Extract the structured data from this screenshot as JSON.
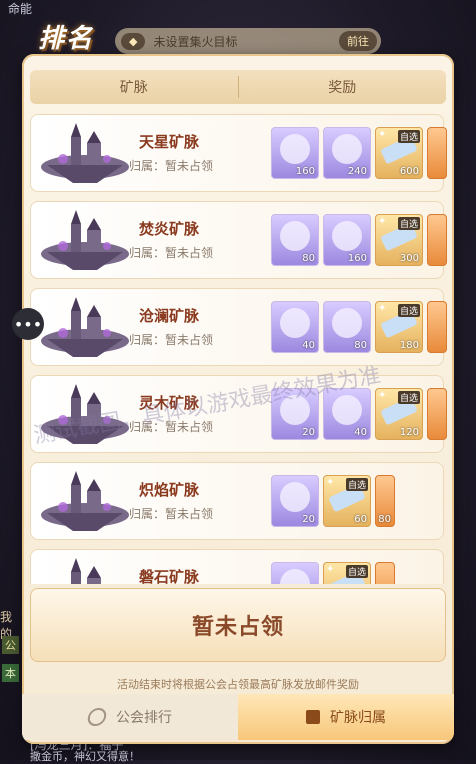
{
  "header": {
    "title": "排名",
    "status_left": "未设置集火目标",
    "status_right": "前往"
  },
  "tabs": {
    "left": "矿脉",
    "right": "奖励"
  },
  "mines": [
    {
      "name": "天星矿脉",
      "owner": "归属：暂未占领",
      "rewards": [
        {
          "kind": "purple",
          "count": "160"
        },
        {
          "kind": "purple",
          "count": "240"
        },
        {
          "kind": "gold",
          "count": "600",
          "tag": "自选"
        },
        {
          "kind": "orange",
          "count": ""
        }
      ]
    },
    {
      "name": "焚炎矿脉",
      "owner": "归属：暂未占领",
      "rewards": [
        {
          "kind": "purple",
          "count": "80"
        },
        {
          "kind": "purple",
          "count": "160"
        },
        {
          "kind": "gold",
          "count": "300",
          "tag": "自选"
        },
        {
          "kind": "orange",
          "count": ""
        }
      ]
    },
    {
      "name": "沧澜矿脉",
      "owner": "归属：暂未占领",
      "rewards": [
        {
          "kind": "purple",
          "count": "40"
        },
        {
          "kind": "purple",
          "count": "80"
        },
        {
          "kind": "gold",
          "count": "180",
          "tag": "自选"
        },
        {
          "kind": "orange",
          "count": ""
        }
      ]
    },
    {
      "name": "灵木矿脉",
      "owner": "归属：暂未占领",
      "rewards": [
        {
          "kind": "purple",
          "count": "20"
        },
        {
          "kind": "purple",
          "count": "40"
        },
        {
          "kind": "gold",
          "count": "120",
          "tag": "自选"
        },
        {
          "kind": "orange",
          "count": ""
        }
      ]
    },
    {
      "name": "炽焰矿脉",
      "owner": "归属：暂未占领",
      "rewards": [
        {
          "kind": "purple",
          "count": "20"
        },
        {
          "kind": "gold",
          "count": "60",
          "tag": "自选"
        },
        {
          "kind": "orange",
          "count": "80"
        }
      ]
    },
    {
      "name": "磐石矿脉",
      "owner": "",
      "rewards": [
        {
          "kind": "purple",
          "count": ""
        },
        {
          "kind": "gold",
          "count": "",
          "tag": "自选"
        },
        {
          "kind": "orange",
          "count": ""
        }
      ]
    }
  ],
  "claim_label": "暂未占领",
  "note": "活动结束时将根据公会占领最高矿脉发放邮件奖励",
  "bottom_tabs": {
    "guild_rank": "公会排行",
    "mine_owner": "矿脉归属"
  },
  "watermark": "测试截图，具体以游戏最终效果为准",
  "background": {
    "top_left": "命能",
    "left_mid": "我的",
    "left_tag1": "公",
    "left_tag2": "本",
    "bottom1": "[冯龙三月]：福子",
    "bottom2": "撒金币，神幻又得意！"
  }
}
